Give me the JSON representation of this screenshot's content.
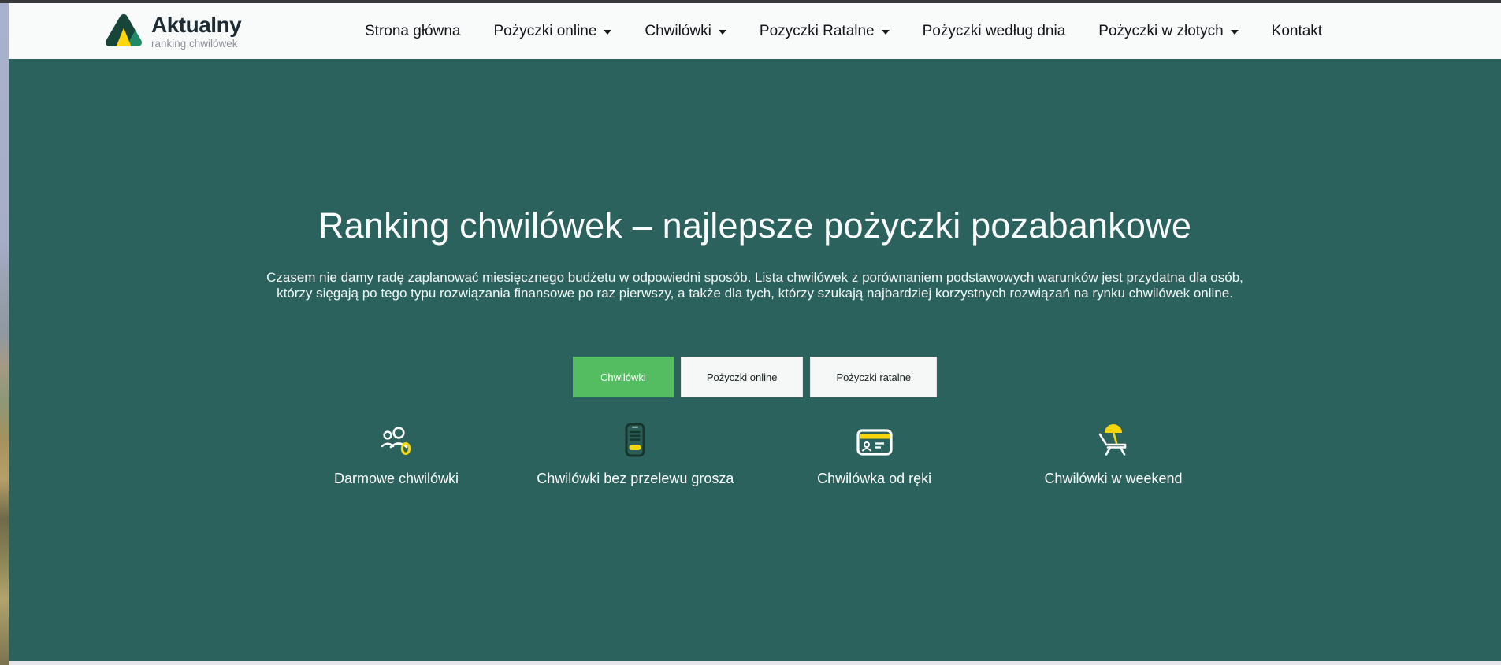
{
  "theme": {
    "hero_background": "#2c625d",
    "navbar_background": "#f9fafa",
    "accent_green": "#54bd62",
    "accent_yellow": "#f6d70e",
    "logo_dark_green": "#17453a",
    "logo_teal": "#1f8a68"
  },
  "nav": {
    "logo": {
      "title": "Aktualny",
      "subtitle": "ranking chwilówek",
      "icon": "logo-triangle-icon"
    },
    "items": [
      {
        "label": "Strona główna",
        "dropdown": false
      },
      {
        "label": "Pożyczki online",
        "dropdown": true
      },
      {
        "label": "Chwilówki",
        "dropdown": true
      },
      {
        "label": "Pozyczki Ratalne",
        "dropdown": true
      },
      {
        "label": "Pożyczki według dnia",
        "dropdown": false
      },
      {
        "label": "Pożyczki w złotych",
        "dropdown": true
      },
      {
        "label": "Kontakt",
        "dropdown": false
      }
    ]
  },
  "hero": {
    "title": "Ranking chwilówek – najlepsze pożyczki pozabankowe",
    "description": "Czasem nie damy radę zaplanować miesięcznego budżetu w odpowiedni sposób. Lista chwilówek z porównaniem podstawowych warunków jest przydatna dla osób, którzy sięgają po tego typu rozwiązania finansowe po raz pierwszy, a także dla tych, którzy szukają najbardziej korzystnych rozwiązań na rynku chwilówek online.",
    "buttons": [
      {
        "label": "Chwilówki",
        "active": true
      },
      {
        "label": "Pożyczki online",
        "active": false
      },
      {
        "label": "Pożyczki ratalne",
        "active": false
      }
    ],
    "features": [
      {
        "label": "Darmowe chwilówki",
        "icon": "people-zero-icon"
      },
      {
        "label": "Chwilówki bez przelewu grosza",
        "icon": "phone-icon"
      },
      {
        "label": "Chwilówka od ręki",
        "icon": "id-card-icon"
      },
      {
        "label": "Chwilówki w weekend",
        "icon": "beach-chair-icon"
      }
    ]
  }
}
